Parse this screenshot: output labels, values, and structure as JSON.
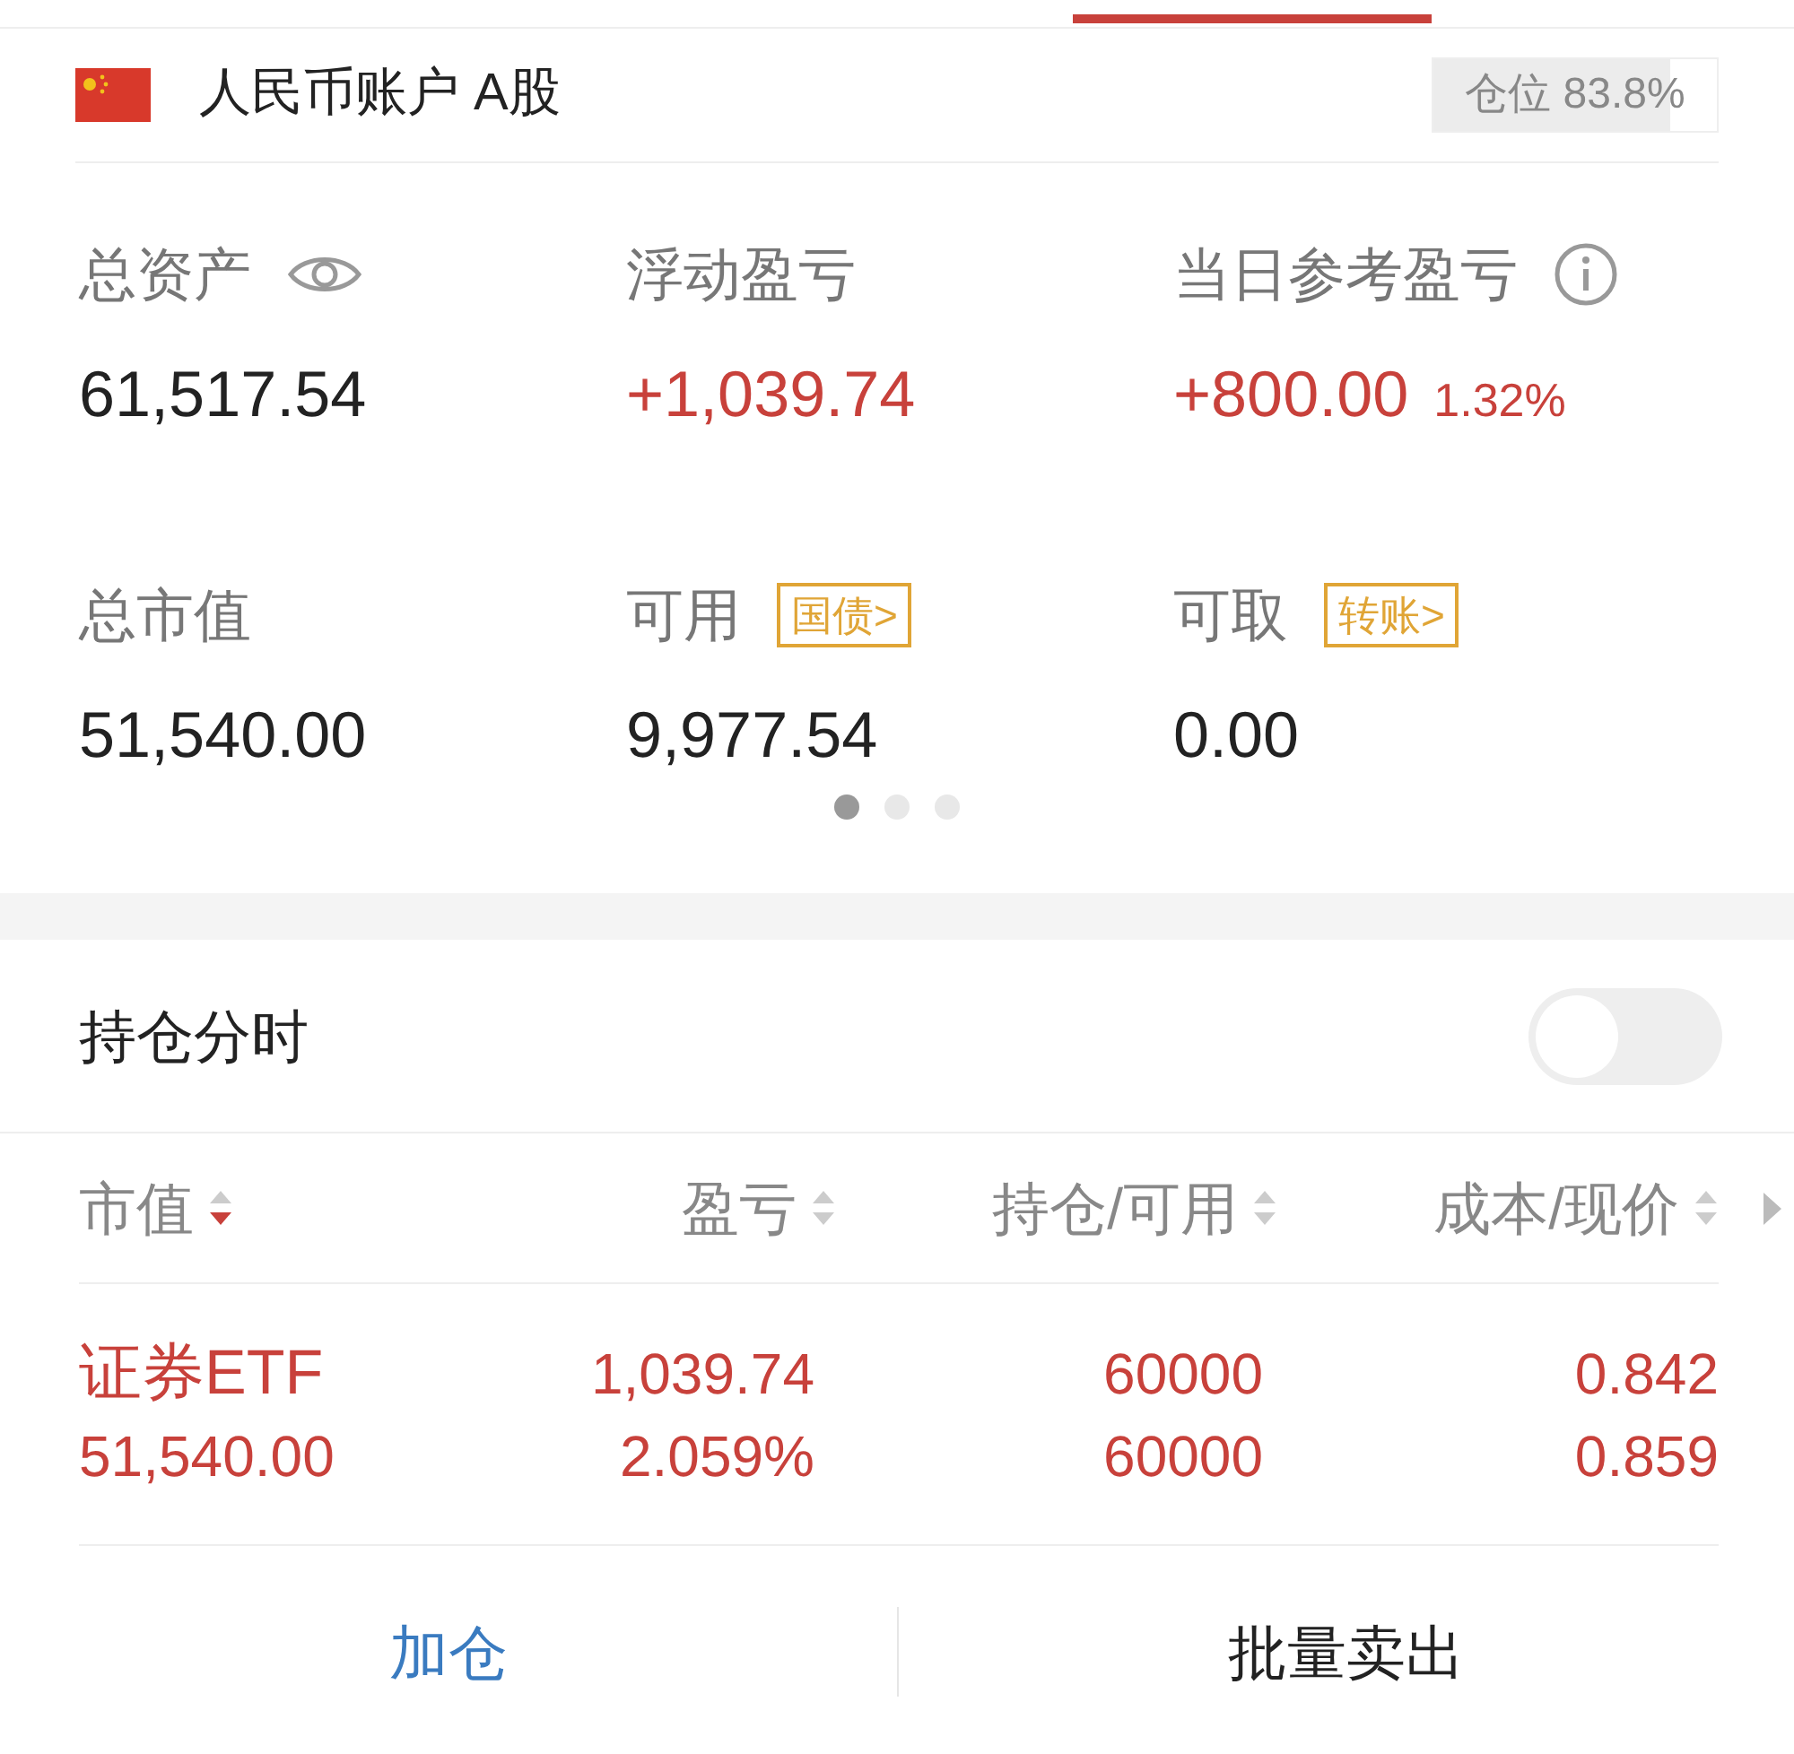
{
  "account": {
    "name": "人民币账户 A股",
    "position": {
      "label": "仓位 83.8%",
      "level": 0.838
    }
  },
  "stats": [
    {
      "kind": "eye",
      "label": "总资产",
      "value": "61,517.54",
      "gain": false
    },
    {
      "kind": "plain",
      "label": "浮动盈亏",
      "value": "+1,039.74",
      "gain": true
    },
    {
      "kind": "info",
      "label": "当日参考盈亏",
      "value": "+800.00",
      "extra": "1.32%",
      "gain": true
    },
    {
      "kind": "plain",
      "label": "总市值",
      "value": "51,540.00",
      "gain": false
    },
    {
      "kind": "tag",
      "label": "可用",
      "value": "9,977.54",
      "gain": false,
      "tag": "国债>"
    },
    {
      "kind": "tag",
      "label": "可取",
      "value": "0.00",
      "gain": false,
      "tag": "转账>"
    }
  ],
  "pager": [
    {
      "selected": true
    },
    {
      "selected": false
    },
    {
      "selected": false
    }
  ],
  "intraday_toggle": {
    "label": "持仓分时",
    "on": false
  },
  "table": {
    "columns": [
      {
        "label": "市值",
        "sorted": true
      },
      {
        "label": "盈亏",
        "sorted": false
      },
      {
        "label": "持仓/可用",
        "sorted": false
      },
      {
        "label": "成本/现价",
        "sorted": false
      }
    ],
    "rows": [
      {
        "name": "证券ETF",
        "market_value": "51,540.00",
        "pnl": "1,039.74",
        "pnl_pct": "2.059%",
        "holding": "60000",
        "available": "60000",
        "cost": "0.842",
        "price": "0.859",
        "gain": true
      }
    ]
  },
  "buttons": [
    {
      "label": "加仓",
      "kind": "primary"
    },
    {
      "label": "批量卖出",
      "kind": "default"
    }
  ]
}
